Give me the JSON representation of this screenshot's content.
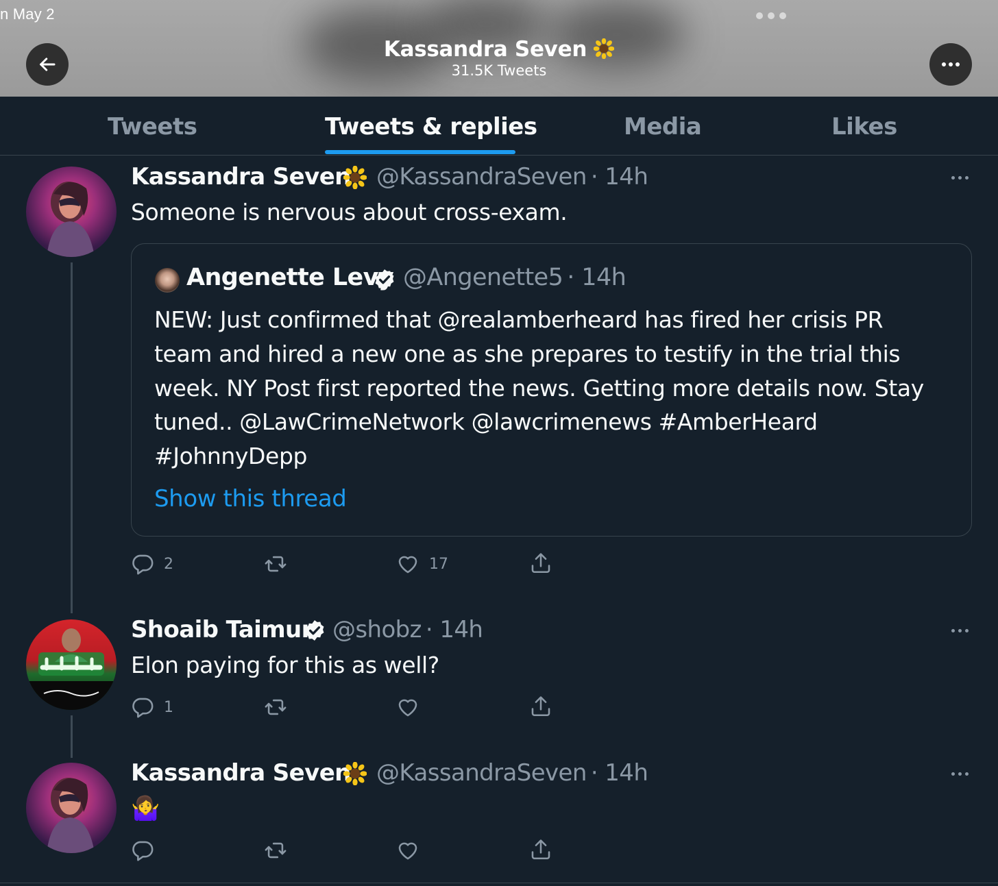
{
  "status_bar": {
    "date": "n May 2"
  },
  "header": {
    "title": "Kassandra Seven",
    "subtitle": "31.5K Tweets",
    "back_icon": "arrow-left-icon",
    "more_icon": "ellipsis-icon"
  },
  "tabs": [
    {
      "label": "Tweets"
    },
    {
      "label": "Tweets & replies"
    },
    {
      "label": "Media"
    },
    {
      "label": "Likes"
    }
  ],
  "active_tab": "Tweets & replies",
  "colors": {
    "background": "#15202b",
    "accent": "#1d9bf0",
    "muted": "#8b98a5",
    "border": "#38444d"
  },
  "tweets": [
    {
      "name": "Kassandra Seven",
      "handle": "@KassandraSeven",
      "time": "· 14h",
      "text": "Someone is nervous about cross-exam.",
      "quote": {
        "name": "Angenette Levy",
        "handle": "@Angenette5",
        "time": "· 14h",
        "lines": [
          "NEW: Just confirmed that @realamberheard has fired her crisis PR",
          "team and hired a new one as she prepares to testify in the trial this",
          "week. NY Post first reported the news. Getting more details now. Stay",
          "tuned.. @LawCrimeNetwork @lawcrimenews #AmberHeard",
          "#JohnnyDepp"
        ],
        "show_thread": "Show this thread"
      },
      "replies": "2",
      "retweets": "",
      "likes": "17"
    },
    {
      "name": "Shoaib Taimur",
      "handle": "@shobz",
      "time": "· 14h",
      "text": "Elon paying for this as well?",
      "replies": "1",
      "retweets": "",
      "likes": ""
    },
    {
      "name": "Kassandra Seven",
      "handle": "@KassandraSeven",
      "time": "· 14h",
      "text": "🤷‍♀️",
      "replies": "",
      "retweets": "",
      "likes": ""
    }
  ]
}
